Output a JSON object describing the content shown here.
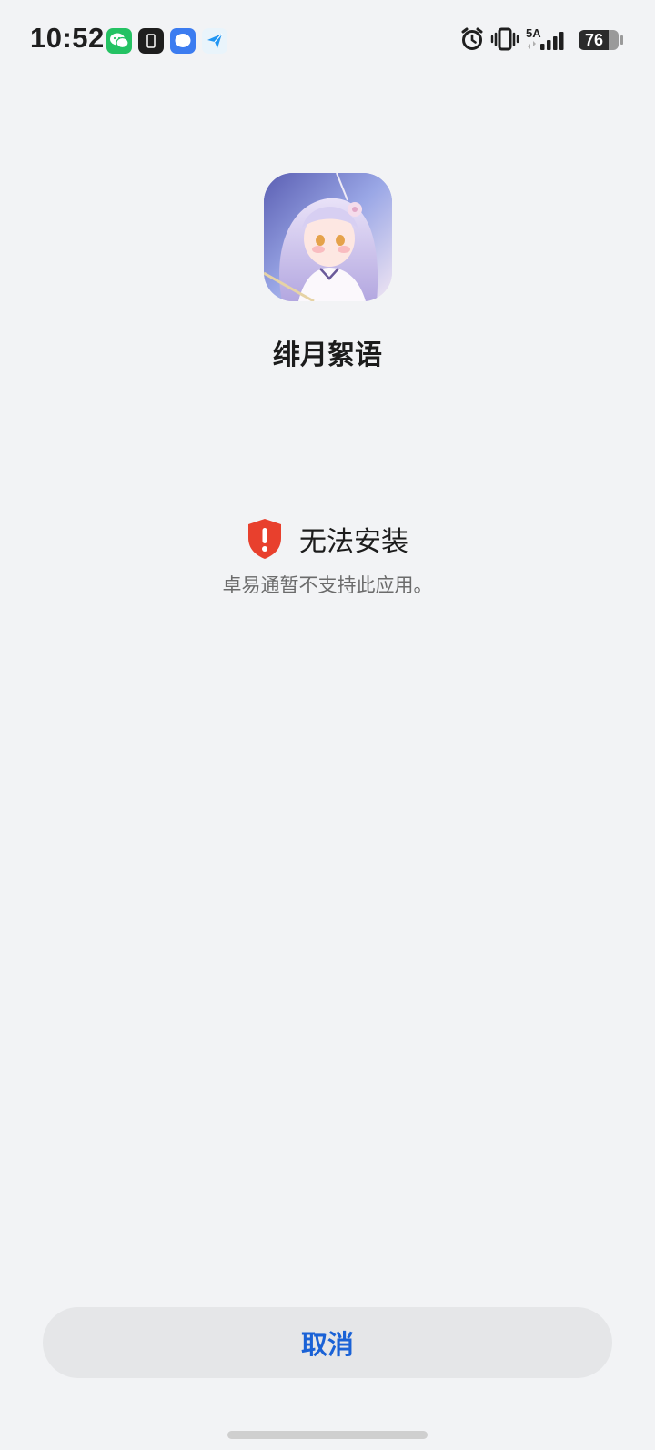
{
  "status_bar": {
    "time": "10:52",
    "network_label": "5A",
    "battery_level": "76",
    "battery_fraction": 0.76,
    "notification_icons": [
      "wechat-icon",
      "dark-app-icon",
      "message-icon",
      "send-app-icon"
    ],
    "system_icons": [
      "alarm-icon",
      "vibrate-icon",
      "signal-icon",
      "battery-icon"
    ]
  },
  "app": {
    "name": "绯月絮语",
    "icon": "app-icon-anime-character"
  },
  "error": {
    "title": "无法安装",
    "description": "卓易通暂不支持此应用。",
    "icon": "shield-alert-icon",
    "icon_color": "#e8402d"
  },
  "actions": {
    "cancel_label": "取消",
    "accent_color": "#1a62d6"
  }
}
